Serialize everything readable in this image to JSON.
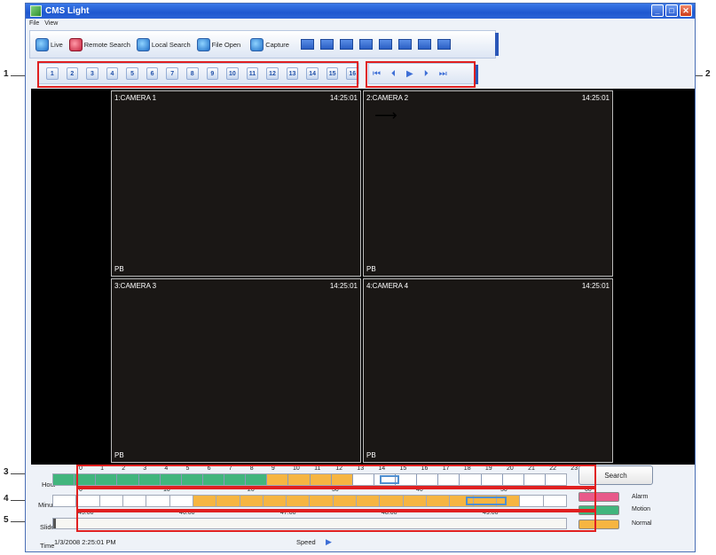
{
  "window": {
    "title": "CMS Light"
  },
  "menu": [
    "File",
    "View"
  ],
  "toolbar": {
    "live": "Live",
    "remote_search": "Remote Search",
    "local_search": "Local Search",
    "file_open": "File Open",
    "capture": "Capture",
    "layout_icons": [
      "layout-1-icon",
      "layout-4-icon",
      "layout-6-icon",
      "layout-8-icon",
      "layout-9-icon",
      "layout-10-icon",
      "layout-13-icon",
      "layout-16-icon"
    ]
  },
  "channels": [
    "1",
    "2",
    "3",
    "4",
    "5",
    "6",
    "7",
    "8",
    "9",
    "10",
    "11",
    "12",
    "13",
    "14",
    "15",
    "16"
  ],
  "playback_controls": [
    "⏮",
    "⏴",
    "▶",
    "⏵",
    "⏭"
  ],
  "cameras": [
    {
      "name": "1:CAMERA 1",
      "time": "14:25:01",
      "label": "PB"
    },
    {
      "name": "2:CAMERA 2",
      "time": "14:25:01",
      "label": "PB"
    },
    {
      "name": "3:CAMERA 3",
      "time": "14:25:01",
      "label": "PB"
    },
    {
      "name": "4:CAMERA 4",
      "time": "14:25:01",
      "label": "PB"
    }
  ],
  "timeline": {
    "hour_label": "Hour",
    "minute_label": "Minute",
    "slide_label": "Slide",
    "time_label": "Time",
    "hour_ticks": [
      "0",
      "1",
      "2",
      "3",
      "4",
      "5",
      "6",
      "7",
      "8",
      "9",
      "10",
      "11",
      "12",
      "13",
      "14",
      "15",
      "16",
      "17",
      "18",
      "19",
      "20",
      "21",
      "22",
      "23",
      "24"
    ],
    "minute_ticks": [
      "0",
      "10",
      "20",
      "30",
      "40",
      "50",
      "60"
    ],
    "slide_ticks": [
      "45:00",
      "46:00",
      "47:00",
      "48:00",
      "49:00",
      "50:00"
    ],
    "time_value": "1/3/2008 2:25:01 PM",
    "speed_label": "Speed",
    "search_button": "Search"
  },
  "legend": [
    {
      "label": "Alarm",
      "color": "#e85a8a"
    },
    {
      "label": "Motion",
      "color": "#41b57d"
    },
    {
      "label": "Normal",
      "color": "#f6b542"
    }
  ],
  "callouts": [
    "1",
    "2",
    "3",
    "4",
    "5"
  ]
}
